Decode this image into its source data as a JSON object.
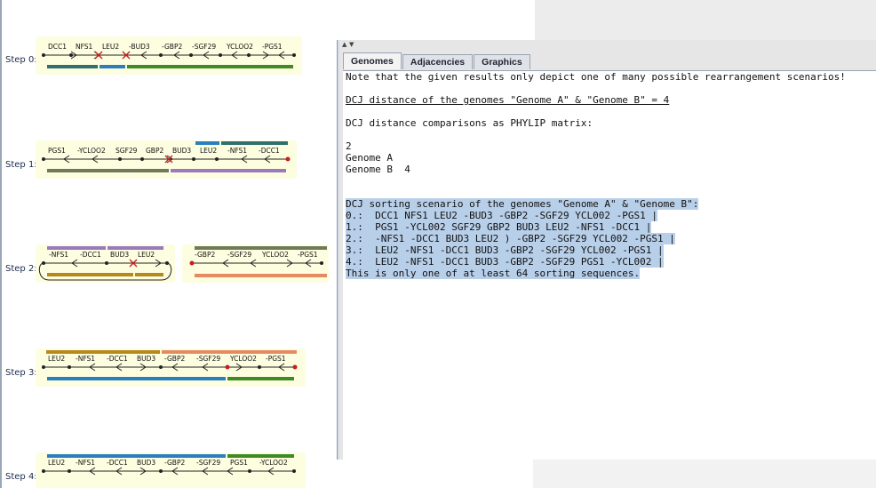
{
  "steps": [
    {
      "label": "Step 0:",
      "genes": [
        "DCC1",
        "NFS1",
        "LEU2",
        "-BUD3",
        "-GBP2",
        "-SGF29",
        "YCLOO2",
        "-PGS1"
      ]
    },
    {
      "label": "Step 1:",
      "genes": [
        "PGS1",
        "-YCLOO2",
        "SGF29",
        "GBP2",
        "BUD3",
        "LEU2",
        "-NFS1",
        "-DCC1"
      ]
    },
    {
      "label": "Step 2:",
      "genes_a": [
        "-NFS1",
        "-DCC1",
        "BUD3",
        "LEU2"
      ],
      "genes_b": [
        "-GBP2",
        "-SGF29",
        "YCLOO2",
        "-PGS1"
      ]
    },
    {
      "label": "Step 3:",
      "genes": [
        "LEU2",
        "-NFS1",
        "-DCC1",
        "BUD3",
        "-GBP2",
        "-SGF29",
        "YCLOO2",
        "-PGS1"
      ]
    },
    {
      "label": "Step 4:",
      "genes": [
        "LEU2",
        "-NFS1",
        "-DCC1",
        "BUD3",
        "-GBP2",
        "-SGF29",
        "PGS1",
        "-YCLOO2"
      ]
    }
  ],
  "colors": {
    "green": "#3f8a23",
    "blue": "#2a7fbf",
    "purple": "#9a79be",
    "olive": "#707a58",
    "teal": "#2f6f6c",
    "gold": "#b8891a",
    "salmon": "#e58a63",
    "red": "#c81e1e"
  },
  "tabs": [
    "Genomes",
    "Adjacencies",
    "Graphics"
  ],
  "lines": [
    "Note that the given results only depict one of many possible rearrangement scenarios!",
    "",
    "DCJ distance of the genomes \"Genome A\" & \"Genome B\" = 4",
    "",
    "DCJ distance comparisons as PHYLIP matrix:",
    "",
    "2",
    "Genome A",
    "Genome B  4",
    "",
    "",
    "DCJ sorting scenario of the genomes \"Genome A\" & \"Genome B\":",
    "0.:  DCC1 NFS1 LEU2 -BUD3 -GBP2 -SGF29 YCL002 -PGS1 |",
    "1.:  PGS1 -YCL002 SGF29 GBP2 BUD3 LEU2 -NFS1 -DCC1 |",
    "2.:  -NFS1 -DCC1 BUD3 LEU2 ) -GBP2 -SGF29 YCL002 -PGS1 |",
    "3.:  LEU2 -NFS1 -DCC1 BUD3 -GBP2 -SGF29 YCL002 -PGS1 |",
    "4.:  LEU2 -NFS1 -DCC1 BUD3 -GBP2 -SGF29 PGS1 -YCL002 |",
    "This is only one of at least 64 sorting sequences."
  ]
}
